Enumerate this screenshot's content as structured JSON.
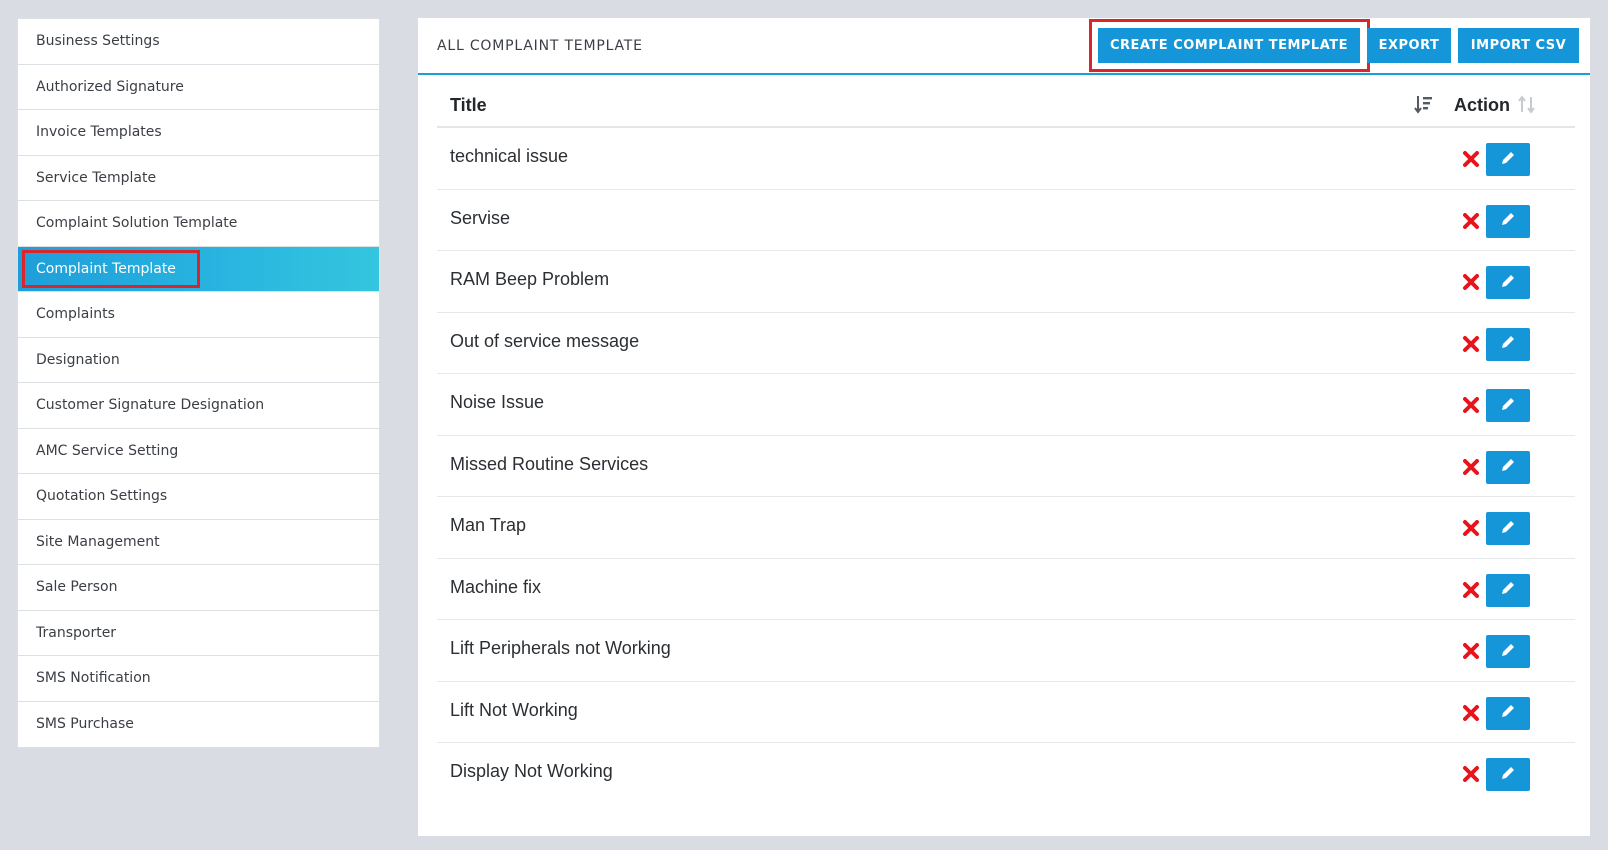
{
  "sidebar": {
    "items": [
      {
        "label": "Business Settings"
      },
      {
        "label": "Authorized Signature"
      },
      {
        "label": "Invoice Templates"
      },
      {
        "label": "Service Template"
      },
      {
        "label": "Complaint Solution Template"
      },
      {
        "label": "Complaint Template",
        "active": true
      },
      {
        "label": "Complaints"
      },
      {
        "label": "Designation"
      },
      {
        "label": "Customer Signature Designation"
      },
      {
        "label": "AMC Service Setting"
      },
      {
        "label": "Quotation Settings"
      },
      {
        "label": "Site Management"
      },
      {
        "label": "Sale Person"
      },
      {
        "label": "Transporter"
      },
      {
        "label": "SMS Notification"
      },
      {
        "label": "SMS Purchase"
      }
    ]
  },
  "panel": {
    "title": "ALL COMPLAINT TEMPLATE",
    "buttons": {
      "create": "CREATE COMPLAINT TEMPLATE",
      "export": "EXPORT",
      "import": "IMPORT CSV"
    }
  },
  "table": {
    "headers": {
      "title": "Title",
      "action": "Action"
    },
    "rows": [
      {
        "title": "technical issue"
      },
      {
        "title": "Servise"
      },
      {
        "title": "RAM Beep Problem"
      },
      {
        "title": "Out of service message"
      },
      {
        "title": "Noise Issue"
      },
      {
        "title": "Missed Routine Services"
      },
      {
        "title": "Man Trap"
      },
      {
        "title": "Machine fix"
      },
      {
        "title": "Lift Peripherals not Working"
      },
      {
        "title": "Lift Not Working"
      },
      {
        "title": "Display Not Working"
      }
    ]
  },
  "icons": {
    "delete": "close-x-icon",
    "edit": "pencil-icon",
    "sort_active": "sort-desc-icon",
    "sort_inactive": "sort-icon"
  },
  "colors": {
    "accent": "#1596d9",
    "highlight": "#d9262d",
    "delete": "#e8141c"
  }
}
